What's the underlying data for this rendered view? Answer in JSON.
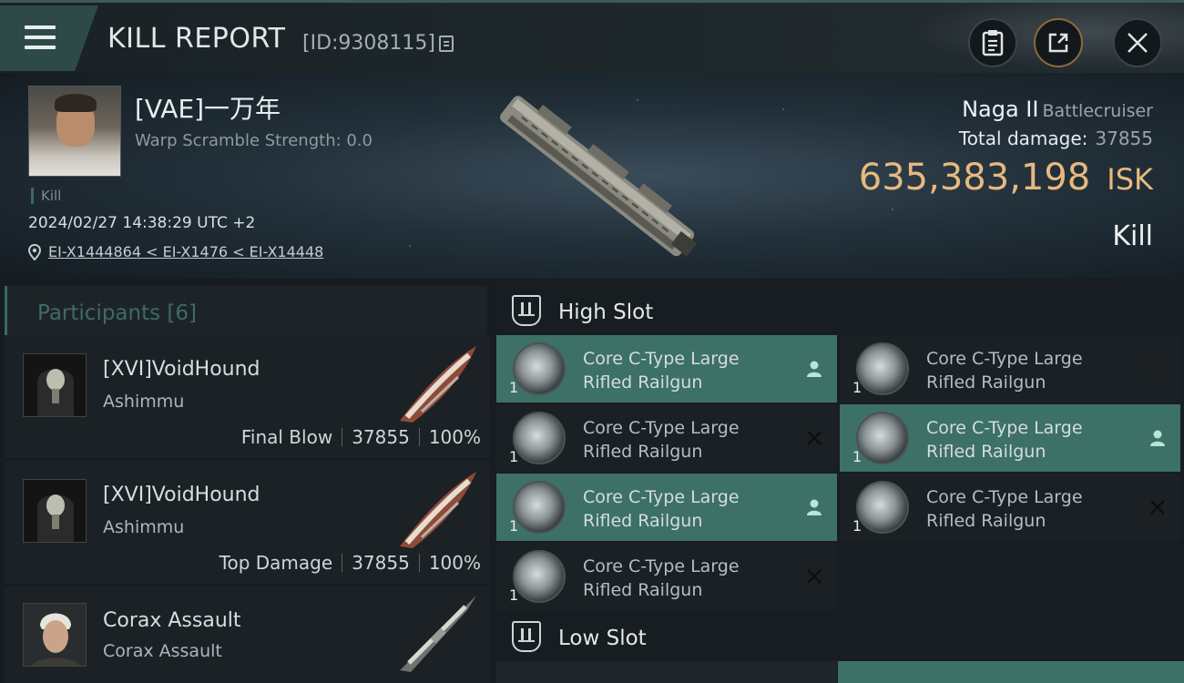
{
  "header": {
    "title": "KILL REPORT",
    "report_id": "[ID:9308115]",
    "buttons": [
      "report-button",
      "share-button",
      "close-button"
    ]
  },
  "victim": {
    "pilot_name": "[VAE]一万年",
    "warp_scramble": "Warp Scramble Strength: 0.0",
    "tag": "Kill",
    "datetime": "2024/02/27 14:38:29 UTC +2",
    "location": "EI-X1444864 < EI-X1476 < EI-X14448",
    "ship_name": "Naga II",
    "ship_class": "Battlecruiser",
    "total_damage_label": "Total damage:",
    "total_damage": "37855",
    "isk_value": "635,383,198",
    "isk_unit": "ISK",
    "result": "Kill"
  },
  "participants": {
    "header": "Participants [6]",
    "rows": [
      {
        "name": "[XVI]VoidHound",
        "ship": "Ashimmu",
        "label": "Final Blow",
        "damage": "37855",
        "percent": "100%"
      },
      {
        "name": "[XVI]VoidHound",
        "ship": "Ashimmu",
        "label": "Top Damage",
        "damage": "37855",
        "percent": "100%"
      },
      {
        "name": "Corax Assault",
        "ship": "Corax Assault",
        "label": "",
        "damage": "",
        "percent": ""
      }
    ]
  },
  "fitting": {
    "high_slot_title": "High Slot",
    "low_slot_title": "Low Slot",
    "modules": [
      {
        "line1": "Core C-Type Large",
        "line2": "Rifled Railgun",
        "qty": "1",
        "status": "dropped"
      },
      {
        "line1": "Core C-Type Large",
        "line2": "Rifled Railgun",
        "qty": "1",
        "status": "destroyed"
      },
      {
        "line1": "Core C-Type Large",
        "line2": "Rifled Railgun",
        "qty": "1",
        "status": "destroyed"
      },
      {
        "line1": "Core C-Type Large",
        "line2": "Rifled Railgun",
        "qty": "1",
        "status": "dropped"
      },
      {
        "line1": "Core C-Type Large",
        "line2": "Rifled Railgun",
        "qty": "1",
        "status": "dropped"
      },
      {
        "line1": "Core C-Type Large",
        "line2": "Rifled Railgun",
        "qty": "1",
        "status": "destroyed"
      },
      {
        "line1": "Core C-Type Large",
        "line2": "Rifled Railgun",
        "qty": "1",
        "status": "destroyed"
      }
    ]
  },
  "colors": {
    "accent_teal": "#3d7067",
    "isk_gold": "#e7b97e",
    "panel": "#1a2023"
  }
}
